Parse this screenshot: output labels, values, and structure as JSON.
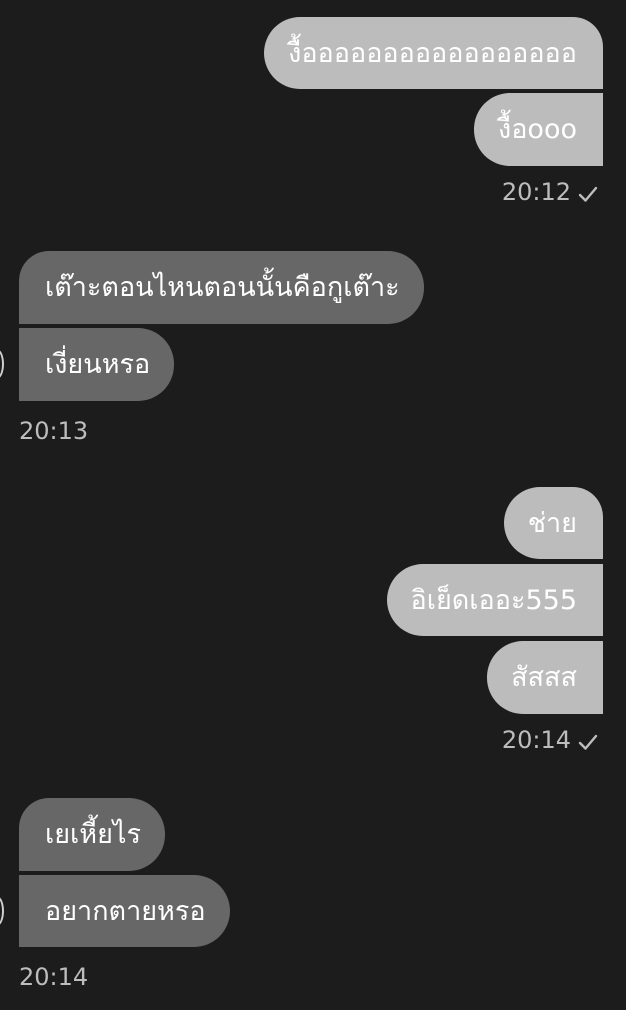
{
  "messages": [
    {
      "direction": "out",
      "text": "งื้อออออออออออออออออ"
    },
    {
      "direction": "out",
      "text": "งื้อooo"
    },
    {
      "direction": "in",
      "text": "เต๊าะตอนไหนตอนนั้นคือกูเต๊าะ"
    },
    {
      "direction": "in",
      "text": "เงี่ยนหรอ"
    },
    {
      "direction": "out",
      "text": "ช่าย"
    },
    {
      "direction": "out",
      "text": "อิเย็ดเออะ555"
    },
    {
      "direction": "out",
      "text": "สัสสส"
    },
    {
      "direction": "in",
      "text": "เยเหี้ยไร"
    },
    {
      "direction": "in",
      "text": "อยากตายหรอ"
    }
  ],
  "timestamps": {
    "group1": "20:12",
    "group2": "20:13",
    "group3": "20:14",
    "group4": "20:14"
  },
  "icons": {
    "read_receipt": "check-icon",
    "avatar": "avatar-icon"
  },
  "colors": {
    "background": "#1c1c1c",
    "outgoing_bubble": "#bcbcbc",
    "incoming_bubble": "#676767",
    "timestamp": "#bdbdbd"
  }
}
